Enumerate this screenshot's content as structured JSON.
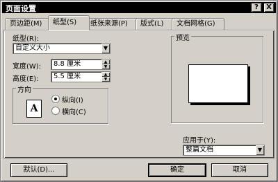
{
  "window": {
    "title": "页面设置",
    "help_label": "?",
    "close_label": "X"
  },
  "tabs": [
    {
      "label": "页边距(M)",
      "active": false
    },
    {
      "label": "纸型(S)",
      "active": true
    },
    {
      "label": "纸张来源(P)",
      "active": false
    },
    {
      "label": "版式(L)",
      "active": false
    },
    {
      "label": "文档网格(G)",
      "active": false
    }
  ],
  "paper": {
    "size_label": "纸型(R):",
    "size_value": "自定义大小",
    "width_label": "宽度(W):",
    "width_value": "8.8 厘米",
    "height_label": "高度(E):",
    "height_value": "5.5 厘米"
  },
  "orientation": {
    "group_label": "方向",
    "icon_glyph": "A",
    "portrait_label": "纵向(I)",
    "landscape_label": "横向(C)",
    "selected": "portrait"
  },
  "preview": {
    "group_label": "预览",
    "apply_label": "应用于(Y):",
    "apply_value": "整篇文档"
  },
  "buttons": {
    "default_label": "默认(D)...",
    "ok_label": "确定",
    "cancel_label": "取消"
  },
  "icons": {
    "dropdown": "chevron-down-icon",
    "spin_up": "spin-up-icon",
    "spin_down": "spin-down-icon"
  }
}
